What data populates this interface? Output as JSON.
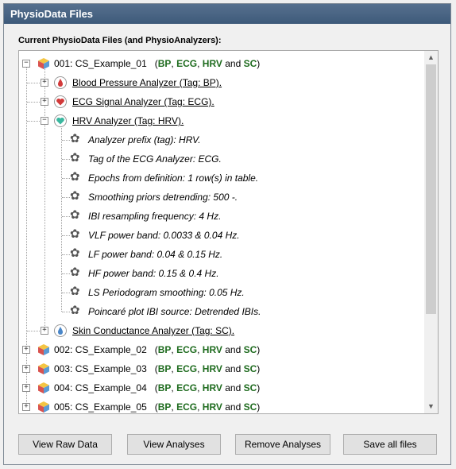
{
  "window": {
    "title": "PhysioData Files"
  },
  "section_label": "Current PhysioData Files (and PhysioAnalyzers):",
  "files": [
    {
      "name": "001: CS_Example_01",
      "tags": [
        "BP",
        "ECG",
        "HRV"
      ],
      "last_tag": "SC"
    },
    {
      "name": "002: CS_Example_02",
      "tags": [
        "BP",
        "ECG",
        "HRV"
      ],
      "last_tag": "SC"
    },
    {
      "name": "003: CS_Example_03",
      "tags": [
        "BP",
        "ECG",
        "HRV"
      ],
      "last_tag": "SC"
    },
    {
      "name": "004: CS_Example_04",
      "tags": [
        "BP",
        "ECG",
        "HRV"
      ],
      "last_tag": "SC"
    },
    {
      "name": "005: CS_Example_05",
      "tags": [
        "BP",
        "ECG",
        "HRV"
      ],
      "last_tag": "SC"
    }
  ],
  "tag_connector": "and",
  "analyzers": [
    {
      "label": "Blood Pressure Analyzer (Tag: BP).",
      "color": "#d23a3a"
    },
    {
      "label": "ECG Signal Analyzer (Tag: ECG).",
      "color": "#d23a3a"
    },
    {
      "label": "HRV Analyzer (Tag: HRV).",
      "color": "#3ab79f"
    },
    {
      "label": "Skin Conductance Analyzer (Tag: SC).",
      "color": "#4a86c8"
    }
  ],
  "hrv_params": [
    "Analyzer prefix (tag): HRV.",
    "Tag of the ECG Analyzer: ECG.",
    "Epochs from definition: 1 row(s) in table.",
    "Smoothing priors detrending: 500 -.",
    "IBI resampling frequency: 4 Hz.",
    "VLF power band: 0.0033 & 0.04 Hz.",
    "LF power band: 0.04 & 0.15 Hz.",
    "HF power band: 0.15 & 0.4 Hz.",
    "LS Periodogram smoothing: 0.05 Hz.",
    "Poincaré plot IBI source: Detrended IBIs."
  ],
  "buttons": {
    "view_raw": "View Raw Data",
    "view_analyses": "View Analyses",
    "remove_analyses": "Remove Analyses",
    "save_all": "Save all files"
  },
  "expander": {
    "plus": "+",
    "minus": "−"
  },
  "scroll": {
    "up": "▲",
    "down": "▼"
  },
  "colors": {
    "title_bar": "#4a6584",
    "tag_green": "#1e6b1e"
  },
  "icons": {
    "file": "cube-icon",
    "param": "gear-icon"
  }
}
